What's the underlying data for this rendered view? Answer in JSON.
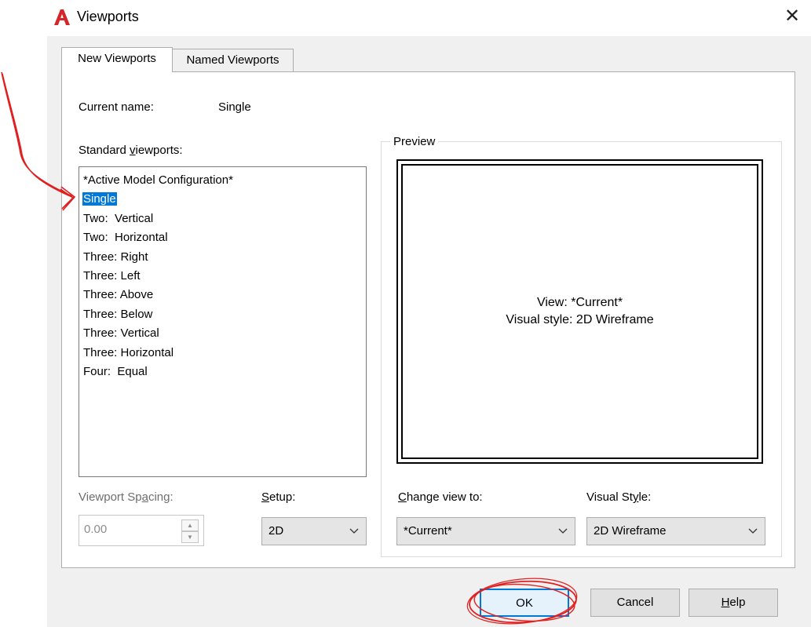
{
  "window": {
    "title": "Viewports",
    "close_glyph": "✕"
  },
  "tabs": [
    {
      "label": "New Viewports",
      "active": true
    },
    {
      "label": "Named Viewports",
      "active": false
    }
  ],
  "current": {
    "label": "Current name:",
    "value": "Single"
  },
  "standard": {
    "label_pre": "Standard ",
    "label_accel": "v",
    "label_post": "iewports:",
    "items": [
      "*Active Model Configuration*",
      "Single",
      "Two:  Vertical",
      "Two:  Horizontal",
      "Three: Right",
      "Three: Left",
      "Three: Above",
      "Three: Below",
      "Three: Vertical",
      "Three: Horizontal",
      "Four:  Equal"
    ],
    "selected_index": 1
  },
  "preview": {
    "legend": "Preview",
    "view_text": "View: *Current*",
    "style_text": "Visual style: 2D Wireframe"
  },
  "spacing": {
    "label_pre": "Viewport Sp",
    "label_accel": "a",
    "label_post": "cing:",
    "value": "0.00",
    "up_glyph": "▲",
    "down_glyph": "▼"
  },
  "setup": {
    "label_accel": "S",
    "label_post": "etup:",
    "value": "2D"
  },
  "change_view": {
    "label_accel": "C",
    "label_post": "hange view to:",
    "value": "*Current*"
  },
  "visual_style": {
    "label_pre": "Visual St",
    "label_accel": "y",
    "label_post": "le:",
    "value": "2D Wireframe"
  },
  "buttons": {
    "ok": "OK",
    "cancel": "Cancel",
    "help_accel": "H",
    "help_post": "elp"
  },
  "colors": {
    "selection": "#0078d7",
    "annotation": "#e02020",
    "logo": "#d4252b"
  }
}
